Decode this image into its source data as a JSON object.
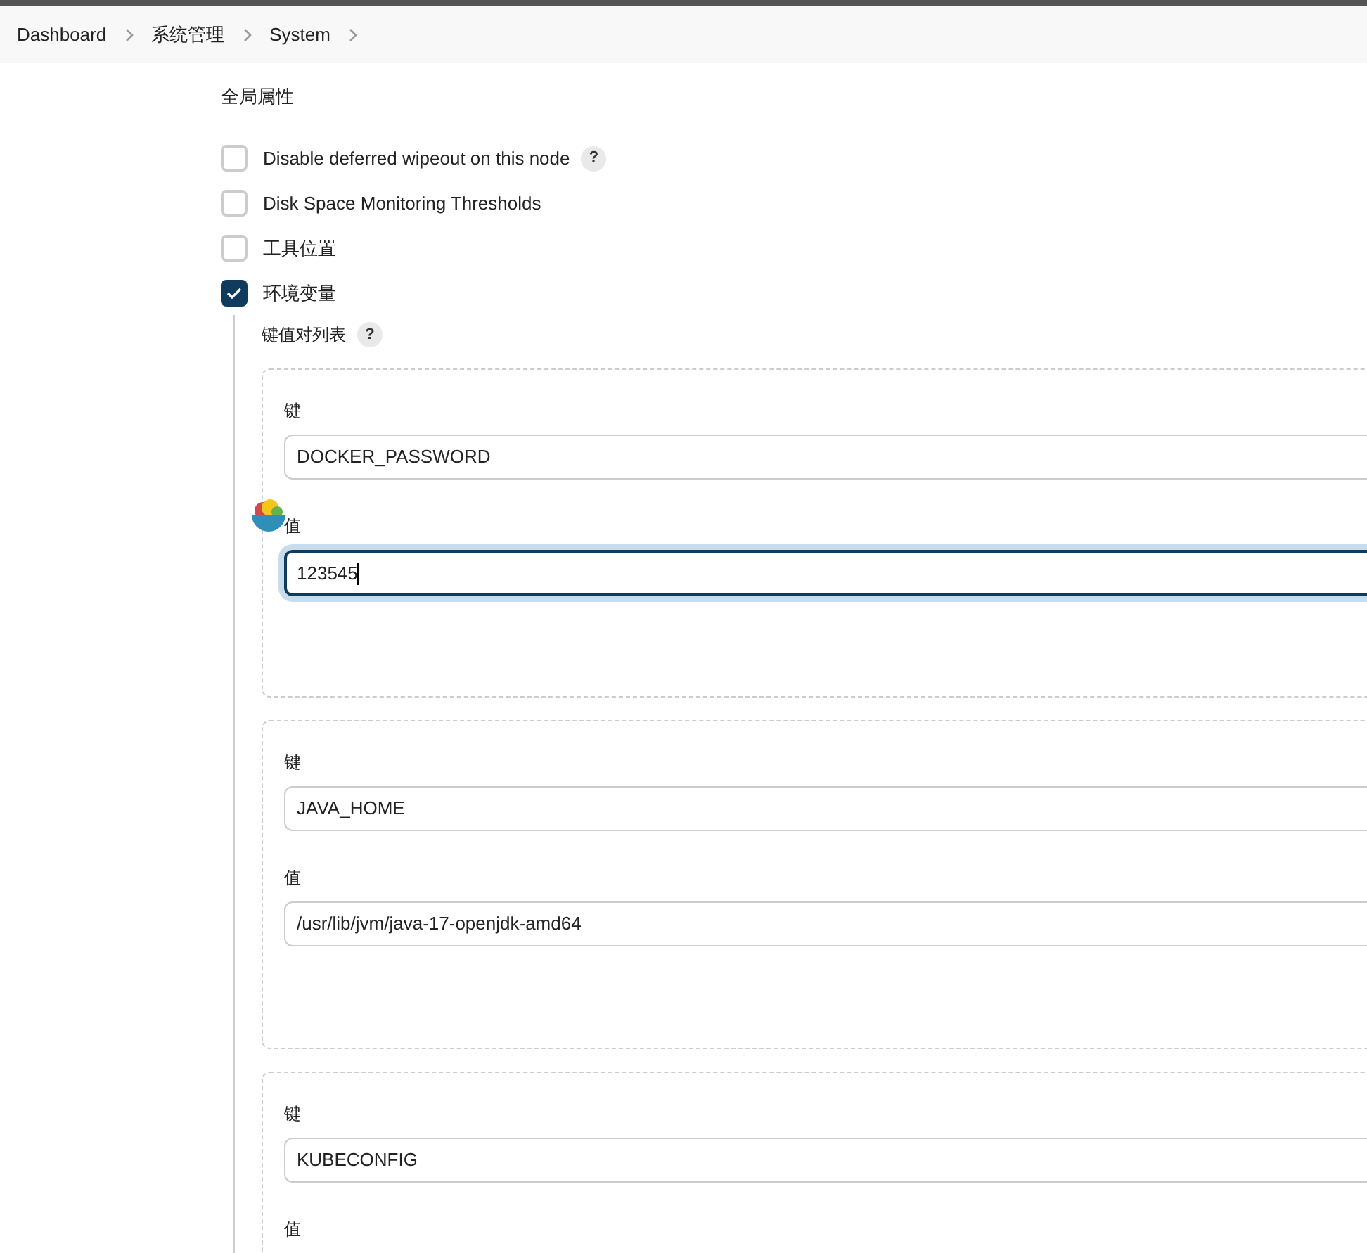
{
  "breadcrumbs": [
    {
      "label": "Dashboard"
    },
    {
      "label": "系统管理"
    },
    {
      "label": "System"
    }
  ],
  "section_title": "全局属性",
  "options": [
    {
      "label": "Disable deferred wipeout on this node",
      "checked": false,
      "help": "?"
    },
    {
      "label": "Disk Space Monitoring Thresholds",
      "checked": false
    },
    {
      "label": "工具位置",
      "checked": false
    },
    {
      "label": "环境变量",
      "checked": true
    }
  ],
  "env_vars": {
    "label": "键值对列表",
    "help": "?",
    "entries": [
      {
        "key_label": "键",
        "key": "DOCKER_PASSWORD",
        "value_label": "值",
        "value": "123545",
        "focused": true
      },
      {
        "key_label": "键",
        "key": "JAVA_HOME",
        "value_label": "值",
        "value": "/usr/lib/jvm/java-17-openjdk-amd64",
        "focused": false
      },
      {
        "key_label": "键",
        "key": "KUBECONFIG",
        "value_label": "值"
      }
    ]
  }
}
